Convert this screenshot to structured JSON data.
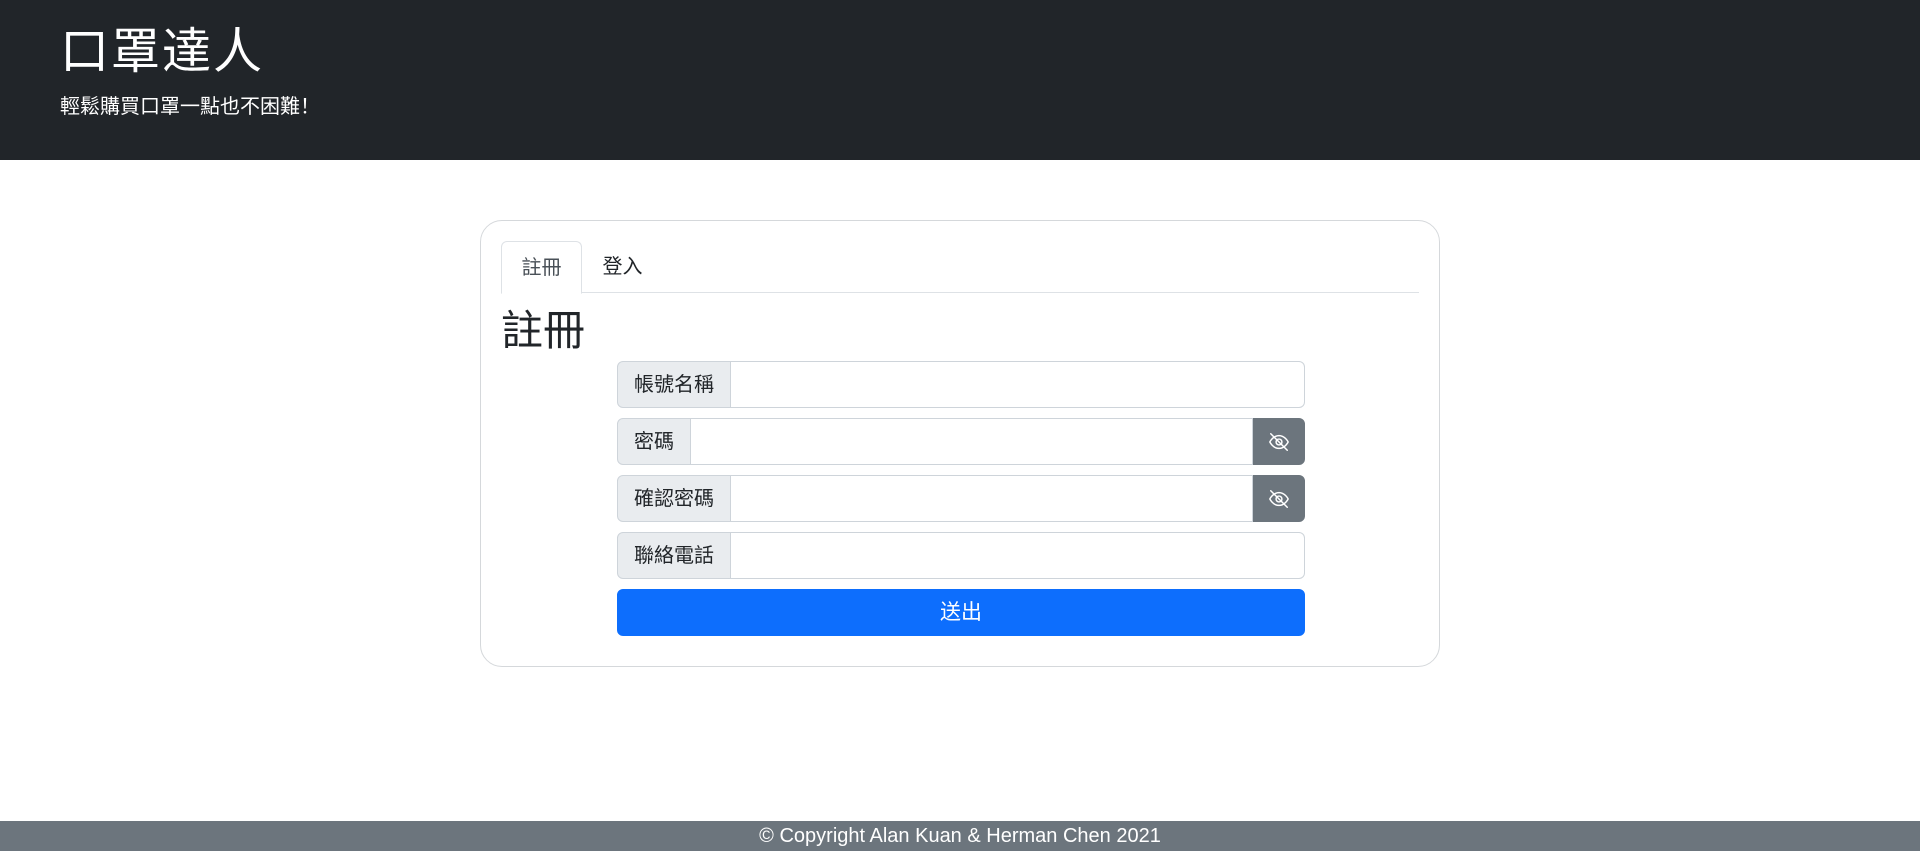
{
  "header": {
    "title": "口罩達人",
    "subtitle": "輕鬆購買口罩一點也不困難！"
  },
  "tabs": [
    {
      "label": "註冊",
      "active": true
    },
    {
      "label": "登入",
      "active": false
    }
  ],
  "form": {
    "heading": "註冊",
    "fields": {
      "username": {
        "label": "帳號名稱",
        "value": "",
        "placeholder": ""
      },
      "password": {
        "label": "密碼",
        "value": "",
        "placeholder": "",
        "toggle_icon": "eye-slash-icon"
      },
      "confirm_password": {
        "label": "確認密碼",
        "value": "",
        "placeholder": "",
        "toggle_icon": "eye-slash-icon"
      },
      "phone": {
        "label": "聯絡電話",
        "value": "",
        "placeholder": ""
      }
    },
    "submit_label": "送出"
  },
  "footer": {
    "text": "© Copyright Alan Kuan & Herman Chen 2021"
  },
  "colors": {
    "header_bg": "#212529",
    "primary": "#0d6efd",
    "secondary": "#6c757d"
  }
}
